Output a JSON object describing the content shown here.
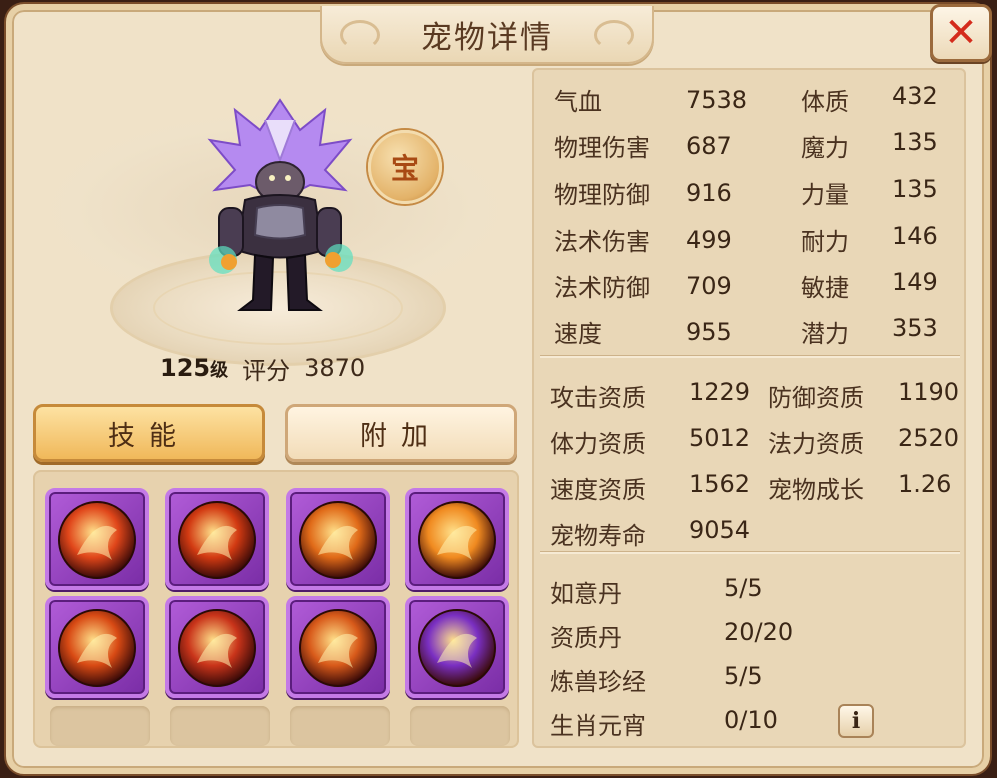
{
  "window": {
    "title": "宠物详情",
    "close_symbol": "✕"
  },
  "pet": {
    "level": "125",
    "level_suffix": "级",
    "score_label": "评分",
    "score": "3870",
    "badge": "宝"
  },
  "tabs": {
    "skills": "技能",
    "extra": "附加"
  },
  "skills": [
    {
      "icon": "phoenix-fire-skill-icon",
      "color": "#e0461a"
    },
    {
      "icon": "demon-mask-skill-icon",
      "color": "#d23a12"
    },
    {
      "icon": "shield-strike-skill-icon",
      "color": "#e06a18"
    },
    {
      "icon": "rabbit-skill-icon",
      "color": "#f08a20"
    },
    {
      "icon": "hourglass-skill-icon",
      "color": "#d84a14"
    },
    {
      "icon": "demon-face-skill-icon",
      "color": "#c9341a"
    },
    {
      "icon": "shield-dragon-skill-icon",
      "color": "#d85a1a"
    },
    {
      "icon": "purple-lightning-skill-icon",
      "color": "#7a2fc2"
    }
  ],
  "attributes": [
    {
      "label": "气血",
      "value": "7538",
      "label2": "体质",
      "value2": "432"
    },
    {
      "label": "物理伤害",
      "value": "687",
      "label2": "魔力",
      "value2": "135"
    },
    {
      "label": "物理防御",
      "value": "916",
      "label2": "力量",
      "value2": "135"
    },
    {
      "label": "法术伤害",
      "value": "499",
      "label2": "耐力",
      "value2": "146"
    },
    {
      "label": "法术防御",
      "value": "709",
      "label2": "敏捷",
      "value2": "149"
    },
    {
      "label": "速度",
      "value": "955",
      "label2": "潜力",
      "value2": "353"
    }
  ],
  "aptitudes": [
    {
      "label": "攻击资质",
      "value": "1229",
      "label2": "防御资质",
      "value2": "1190"
    },
    {
      "label": "体力资质",
      "value": "5012",
      "label2": "法力资质",
      "value2": "2520"
    },
    {
      "label": "速度资质",
      "value": "1562",
      "label2": "宠物成长",
      "value2": "1.26"
    },
    {
      "label": "宠物寿命",
      "value": "9054",
      "label2": "",
      "value2": ""
    }
  ],
  "items": [
    {
      "label": "如意丹",
      "value": "5/5"
    },
    {
      "label": "资质丹",
      "value": "20/20"
    },
    {
      "label": "炼兽珍经",
      "value": "5/5"
    },
    {
      "label": "生肖元宵",
      "value": "0/10"
    }
  ],
  "info_symbol": "i"
}
